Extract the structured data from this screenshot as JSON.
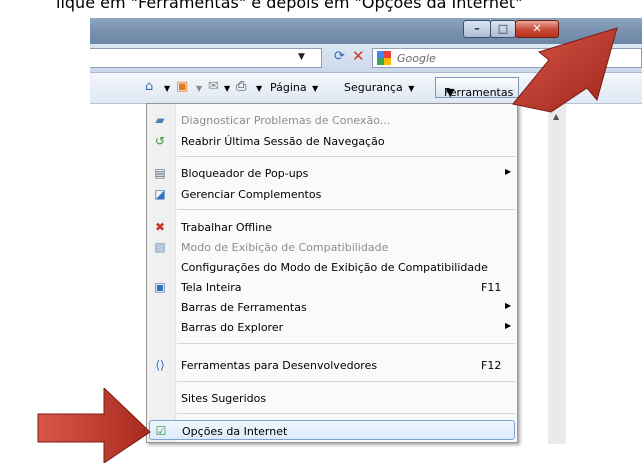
{
  "caption": "lique em \"Ferramentas\" e depois em \"Opções da Internet\"",
  "search": {
    "placeholder": "Google"
  },
  "commandbar": {
    "page_label": "Página",
    "safety_label": "Segurança",
    "tools_label": "Ferramentas"
  },
  "menu": {
    "items": [
      {
        "label": "Diagnosticar Problemas de Conexão...",
        "enabled": false,
        "icon": "network-diagnose-icon"
      },
      {
        "label": "Reabrir Última Sessão de Navegação",
        "enabled": true,
        "icon": "reopen-session-icon"
      },
      {
        "label": "Bloqueador de Pop-ups",
        "enabled": true,
        "icon": "popup-blocker-icon",
        "submenu": true
      },
      {
        "label": "Gerenciar Complementos",
        "enabled": true,
        "icon": "addons-icon"
      },
      {
        "label": "Trabalhar Offline",
        "enabled": true,
        "icon": "offline-icon"
      },
      {
        "label": "Modo de Exibição de Compatibilidade",
        "enabled": false,
        "icon": "compatibility-icon"
      },
      {
        "label": "Configurações do Modo de Exibição de Compatibilidade",
        "enabled": true
      },
      {
        "label": "Tela Inteira",
        "enabled": true,
        "icon": "fullscreen-icon",
        "shortcut": "F11"
      },
      {
        "label": "Barras de Ferramentas",
        "enabled": true,
        "submenu": true
      },
      {
        "label": "Barras do Explorer",
        "enabled": true,
        "submenu": true
      },
      {
        "label": "Ferramentas para Desenvolvedores",
        "enabled": true,
        "icon": "developer-tools-icon",
        "shortcut": "F12"
      },
      {
        "label": "Sites Sugeridos",
        "enabled": true
      },
      {
        "label": "Opções da Internet",
        "enabled": true,
        "icon": "internet-options-icon",
        "highlighted": true
      }
    ]
  },
  "colors": {
    "arrow": "#c0392b",
    "highlight_border": "#7da2ce"
  }
}
